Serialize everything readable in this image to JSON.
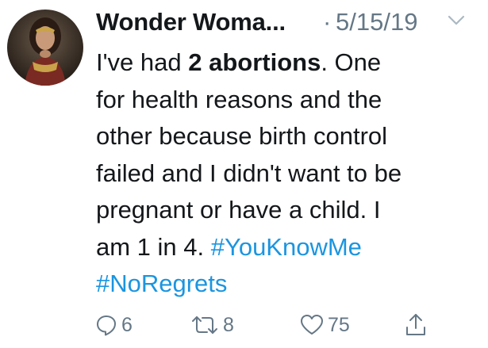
{
  "tweet": {
    "display_name": "Wonder Woma...",
    "separator": "·",
    "timestamp": "5/15/19",
    "body": {
      "line1_a": "I've had ",
      "line1_bold": "2 abortions",
      "line1_b": ". One",
      "line2": "for health reasons and the",
      "line3": "other because birth control",
      "line4": "failed and I didn't want to be",
      "line5": "pregnant or have a child. I",
      "line6_a": "am 1 in 4. ",
      "hashtag1": "#YouKnowMe",
      "hashtag2": "#NoRegrets"
    },
    "actions": {
      "reply_count": "6",
      "retweet_count": "8",
      "like_count": "75"
    }
  },
  "colors": {
    "text": "#14171a",
    "muted": "#657786",
    "link": "#1b95e0"
  },
  "icons": {
    "menu": "chevron-down-icon",
    "reply": "reply-icon",
    "retweet": "retweet-icon",
    "like": "heart-icon",
    "share": "share-icon"
  }
}
